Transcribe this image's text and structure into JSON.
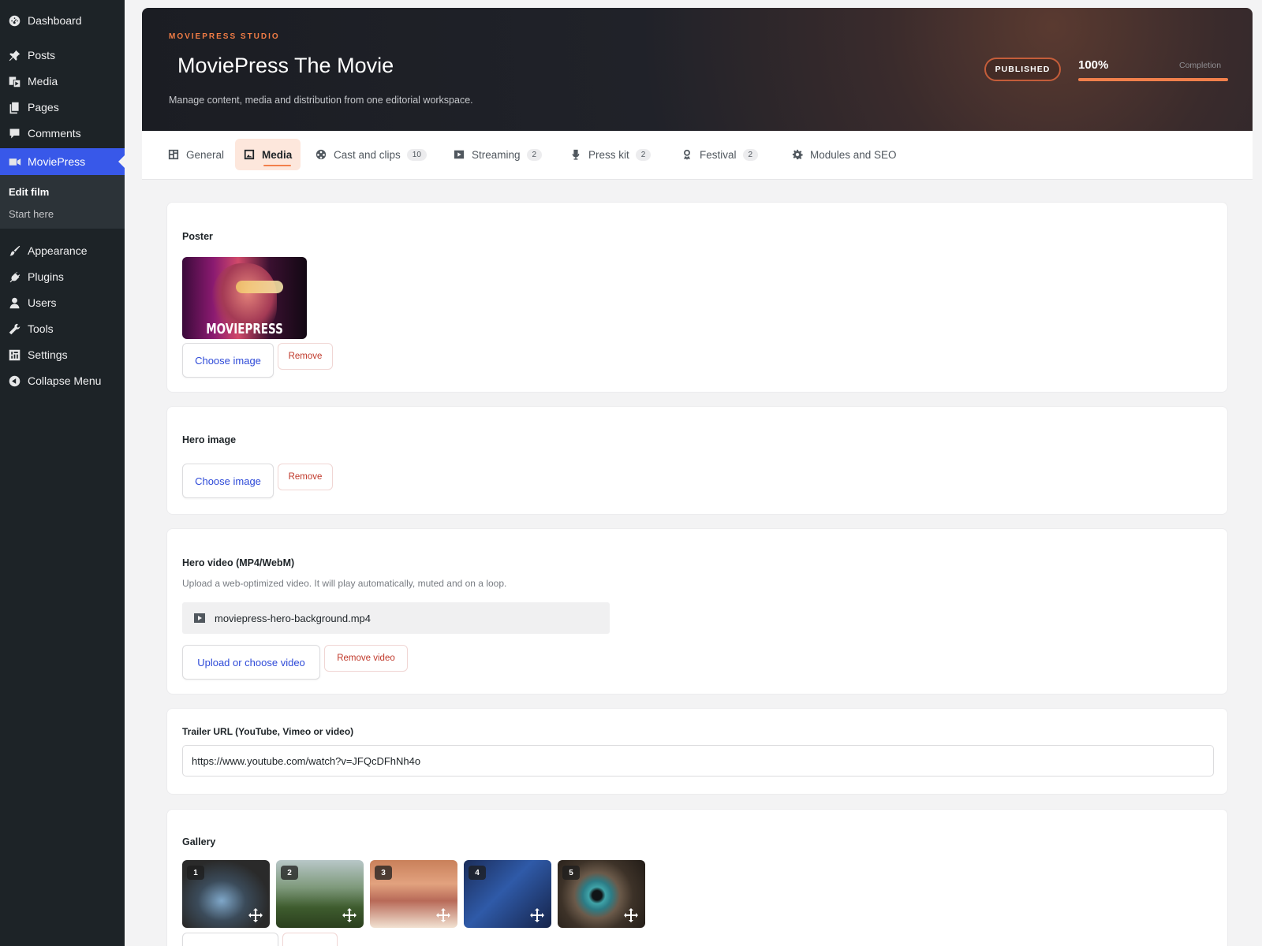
{
  "sidebar": {
    "items": [
      {
        "label": "Dashboard",
        "icon": "dashboard-icon"
      },
      {
        "label": "Posts",
        "icon": "pin-icon"
      },
      {
        "label": "Media",
        "icon": "media-icon"
      },
      {
        "label": "Pages",
        "icon": "pages-icon"
      },
      {
        "label": "Comments",
        "icon": "comment-icon"
      },
      {
        "label": "MoviePress",
        "icon": "video-camera-icon",
        "active": true
      },
      {
        "label": "Appearance",
        "icon": "brush-icon"
      },
      {
        "label": "Plugins",
        "icon": "plugin-icon"
      },
      {
        "label": "Users",
        "icon": "user-icon"
      },
      {
        "label": "Tools",
        "icon": "wrench-icon"
      },
      {
        "label": "Settings",
        "icon": "settings-icon"
      },
      {
        "label": "Collapse Menu",
        "icon": "collapse-icon"
      }
    ],
    "submenu": [
      {
        "label": "Edit film",
        "current": true
      },
      {
        "label": "Start here"
      }
    ]
  },
  "header": {
    "studio": "MOVIEPRESS STUDIO",
    "title": "MoviePress The Movie",
    "subtitle": "Manage content, media and distribution from one editorial workspace.",
    "status": "PUBLISHED",
    "completion_value": "100%",
    "completion_label": "Completion",
    "completion_fraction": 1.0
  },
  "tabs": [
    {
      "label": "General",
      "icon": "layout-icon"
    },
    {
      "label": "Media",
      "icon": "image-icon",
      "active": true
    },
    {
      "label": "Cast and clips",
      "icon": "film-reel-icon",
      "count": "10"
    },
    {
      "label": "Streaming",
      "icon": "play-icon",
      "count": "2"
    },
    {
      "label": "Press kit",
      "icon": "microphone-icon",
      "count": "2"
    },
    {
      "label": "Festival",
      "icon": "award-icon",
      "count": "2"
    },
    {
      "label": "Modules and SEO",
      "icon": "gear-icon"
    }
  ],
  "media": {
    "poster": {
      "label": "Poster",
      "image_text": "MOVIEPRESS",
      "choose_label": "Choose image",
      "remove_label": "Remove"
    },
    "hero_image": {
      "label": "Hero image",
      "choose_label": "Choose image",
      "remove_label": "Remove"
    },
    "hero_video": {
      "label": "Hero video (MP4/WebM)",
      "help": "Upload a web-optimized video. It will play automatically, muted and on a loop.",
      "file_name": "moviepress-hero-background.mp4",
      "upload_label": "Upload or choose video",
      "remove_label": "Remove video"
    },
    "trailer": {
      "label": "Trailer URL (YouTube, Vimeo or video)",
      "value": "https://www.youtube.com/watch?v=JFQcDFhNh4o"
    },
    "gallery": {
      "label": "Gallery",
      "items": [
        {
          "number": "1"
        },
        {
          "number": "2"
        },
        {
          "number": "3"
        },
        {
          "number": "4"
        },
        {
          "number": "5"
        }
      ]
    }
  },
  "colors": {
    "accent": "#f2804c",
    "wp_blue": "#3858e9",
    "sidebar_bg": "#1d2327",
    "remove_red": "#c0392b"
  }
}
